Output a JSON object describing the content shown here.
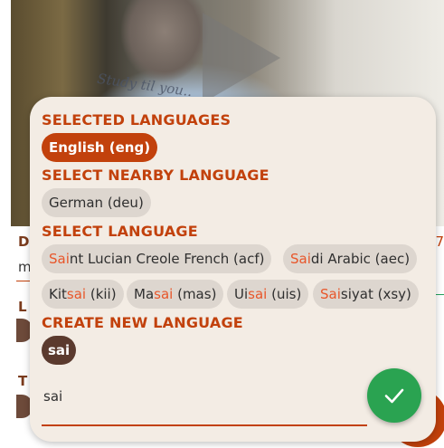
{
  "background": {
    "shirt_text": "Study til you.."
  },
  "underlying": {
    "letters": [
      "D",
      "m",
      "L",
      "T"
    ],
    "number": "7"
  },
  "popup": {
    "selected_title": "SELECTED LANGUAGES",
    "selected": [
      {
        "label": "English (eng)"
      }
    ],
    "nearby_title": "SELECT NEARBY LANGUAGE",
    "nearby": [
      {
        "label": "German (deu)"
      }
    ],
    "select_title": "SELECT LANGUAGE",
    "languages": [
      {
        "pre": "",
        "match": "Sai",
        "post": "nt Lucian Creole French (acf)"
      },
      {
        "pre": "",
        "match": "Sai",
        "post": "di Arabic (aec)"
      },
      {
        "pre": "Kit",
        "match": "sai",
        "post": " (kii)"
      },
      {
        "pre": "Ma",
        "match": "sai",
        "post": " (mas)"
      },
      {
        "pre": "Ui",
        "match": "sai",
        "post": " (uis)"
      },
      {
        "pre": "",
        "match": "Sai",
        "post": "siyat (xsy)"
      }
    ],
    "create_title": "CREATE NEW LANGUAGE",
    "create_chip": "sai",
    "search_value": "sai",
    "confirm_icon": "check-icon"
  },
  "colors": {
    "accent": "#c2410c",
    "highlight": "#e8562a",
    "confirm": "#2aa351",
    "card_bg": "#f3ece4",
    "chip_bg": "#ddd6cf",
    "create_chip_bg": "#5b3a2e"
  }
}
